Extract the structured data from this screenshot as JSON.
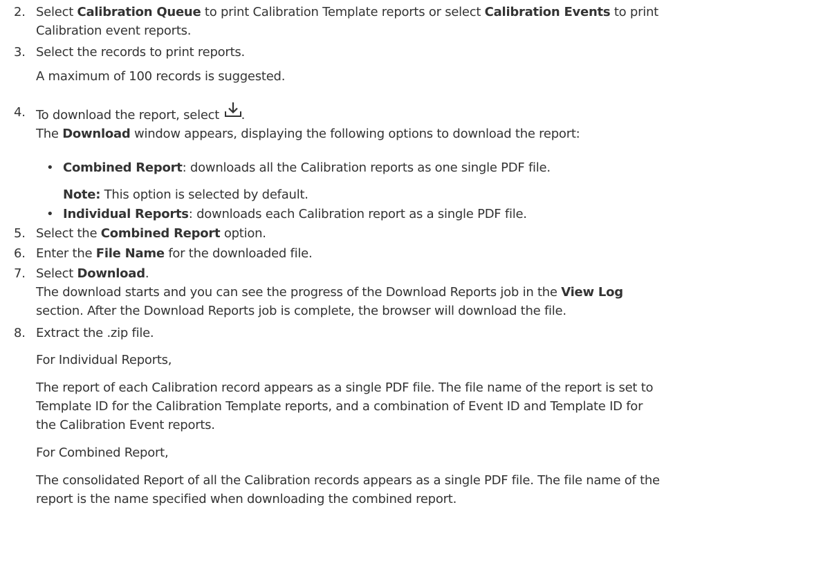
{
  "steps": [
    {
      "num": "2.",
      "pre": "Select ",
      "b1": "Calibration Queue",
      "mid": " to print Calibration Template reports or select ",
      "b2": "Calibration Events",
      "post": " to print",
      "line2": "Calibration event reports."
    },
    {
      "num": "3.",
      "text": "Select the records to print reports.",
      "note": "A maximum of 100 records is suggested."
    },
    {
      "num": "4.",
      "pre": "To download the report, select ",
      "post": ".",
      "icon": "download-icon",
      "l2_pre": "The ",
      "l2_b": "Download",
      "l2_post": " window appears, displaying the following options to download the report:",
      "bullets": [
        {
          "bold": "Combined Report",
          "text": ": downloads all the Calibration reports as one single PDF file.",
          "note_bold": "Note:",
          "note_text": " This option is selected by default."
        },
        {
          "bold": "Individual Reports",
          "text": ": downloads each Calibration report as a single PDF file."
        }
      ]
    },
    {
      "num": "5.",
      "pre": "Select the ",
      "b": "Combined Report",
      "post": " option."
    },
    {
      "num": "6.",
      "pre": "Enter the ",
      "b": "File Name",
      "post": " for the downloaded file."
    },
    {
      "num": "7.",
      "pre": "Select ",
      "b": "Download",
      "post": ".",
      "l2_pre": "The download starts and you can see the progress of the Download Reports job in the ",
      "l2_b": "View Log",
      "l3": "section. After the Download Reports job is complete, the browser will download the file."
    },
    {
      "num": "8.",
      "text": "Extract the .zip file.",
      "p1": "For Individual Reports,",
      "p2_l1": "The report of each Calibration record appears as a single PDF file. The file name of the report is set to",
      "p2_l2": "Template ID for the Calibration Template reports, and a combination of Event ID and Template ID for",
      "p2_l3": "the Calibration Event reports.",
      "p3": "For Combined Report,",
      "p4_l1": "The consolidated Report of all the Calibration records appears as a single PDF file. The file name of the",
      "p4_l2": "report is the name specified when downloading the combined report."
    }
  ]
}
